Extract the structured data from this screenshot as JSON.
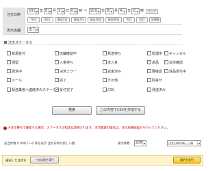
{
  "search_form": {
    "period": {
      "label": "注文日時",
      "start_year": "2019",
      "start_month": "8",
      "start_day": "1",
      "start_hour": "0",
      "end_year": "2019",
      "end_month": "8",
      "end_day": "4",
      "end_hour": "23",
      "unit_year": "年",
      "unit_month": "月",
      "unit_day": "日",
      "unit_hour": "時",
      "range_separator": "〜",
      "clear_label": "クリア",
      "quick_buttons": [
        "今日",
        "昨日",
        "過去3日",
        "過去7日",
        "過去30日",
        "過去90日",
        "今月",
        "先月",
        "全期間"
      ]
    },
    "store": {
      "label": "表示店舗",
      "value": "全て"
    },
    "status": {
      "label": "注文ステータス",
      "options": [
        {
          "label": "新規受付",
          "checked": false
        },
        {
          "label": "店舗確認中",
          "checked": false
        },
        {
          "label": "発送待ち",
          "checked": false
        },
        {
          "label": "処理中",
          "checked": false
        },
        {
          "label": "発送済み",
          "checked": false
        },
        {
          "label": "キャンセル",
          "checked": false
        },
        {
          "label": "保留",
          "checked": false
        },
        {
          "label": "入金待ち",
          "checked": false
        },
        {
          "label": "未入金",
          "checked": false
        },
        {
          "label": "返品",
          "checked": false
        },
        {
          "label": "請求中",
          "checked": false
        },
        {
          "label": "決済エラー",
          "checked": false
        },
        {
          "label": "返金済み",
          "checked": false
        },
        {
          "label": "要確認",
          "checked": false
        },
        {
          "label": "メール",
          "checked": false
        },
        {
          "label": "完了",
          "checked": false
        },
        {
          "label": "その他",
          "checked": false
        },
        {
          "label": "取寄せ",
          "checked": false
        },
        {
          "label": "決済確認",
          "checked": false
        },
        {
          "label": "返品受付中",
          "checked": false
        },
        {
          "label": "配送業者へ連絡済みステータス",
          "checked": false
        },
        {
          "label": "受付完了",
          "checked": true
        },
        {
          "label": "CSV",
          "checked": false
        }
      ]
    },
    "search_button": "検索",
    "csv_button": "この内容でCSVを作成する",
    "notice": "※注文番号で検索する場合、ステータスの指定は無視されます。決済関連の操作は、注文詳細画面から行ってください。"
  },
  "results": {
    "summary": "該当件数 0 件中 1〜0 件を表示  注文日時の新しい順",
    "per_page_label": "表示件数",
    "per_page_value": "20件",
    "sort_value": "注文日時の新しい順"
  },
  "bottom": {
    "selected_label": "選択した注文を",
    "bulk_button": "一括処理を実行",
    "execute_button": "選択を実行"
  }
}
